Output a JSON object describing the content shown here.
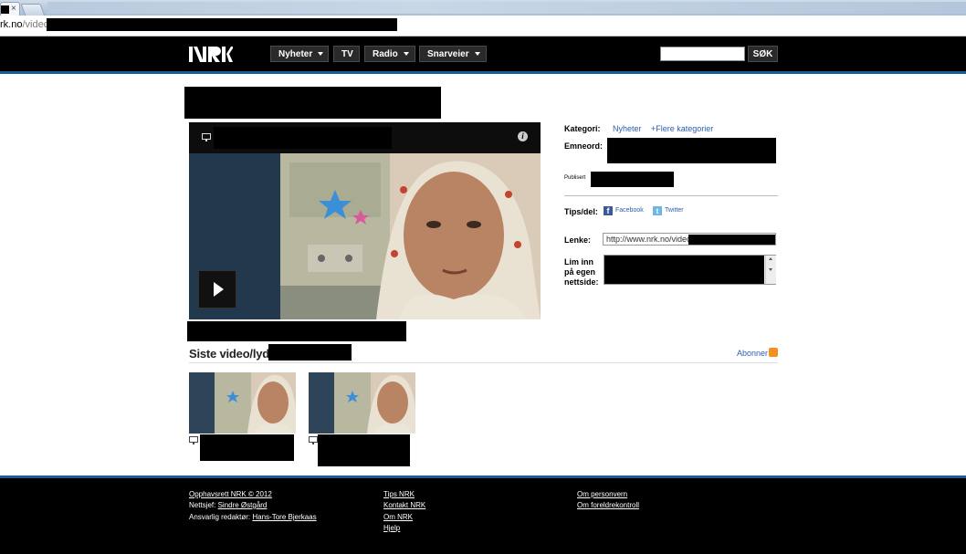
{
  "browser": {
    "tab_close": "×",
    "url_host": "rk.no",
    "url_path": "/video"
  },
  "header": {
    "logo": "NRK",
    "nav": [
      {
        "label": "Nyheter"
      },
      {
        "label": "TV"
      },
      {
        "label": "Radio"
      },
      {
        "label": "Snarveier"
      }
    ],
    "search_button": "SØK",
    "search_value": ""
  },
  "sidebar": {
    "kategori_label": "Kategori:",
    "kategori_value": "Nyheter",
    "flere_kategorier": "+Flere kategorier",
    "emneord_label": "Emneord:",
    "publisert_label": "Publisert",
    "tips_label": "Tips/del:",
    "facebook": "Facebook",
    "twitter": "Twitter",
    "lenke_label": "Lenke:",
    "lenke_value": "http://www.nrk.no/video/",
    "embed_label_1": "Lim inn",
    "embed_label_2": "på egen",
    "embed_label_3": "nettside:"
  },
  "player": {
    "info_glyph": "i"
  },
  "latest": {
    "heading": "Siste video/lyd:",
    "subscribe": "Abonner"
  },
  "footer": {
    "copyright": "Opphavsrett NRK © 2012",
    "nettsjef_label": "Nettsjef:",
    "nettsjef_name": "Sindre Østgård",
    "redaktor_label": "Ansvarlig redaktør:",
    "redaktor_name": "Hans-Tore Bjerkaas",
    "col2": [
      "Tips NRK",
      "Kontakt NRK",
      "Om NRK",
      "Hjelp"
    ],
    "col3": [
      "Om personvern",
      "Om foreldrekontroll"
    ]
  },
  "colors": {
    "accent_blue": "#1e5c96",
    "link_blue": "#2a5fb0",
    "rss_orange": "#f39020"
  }
}
